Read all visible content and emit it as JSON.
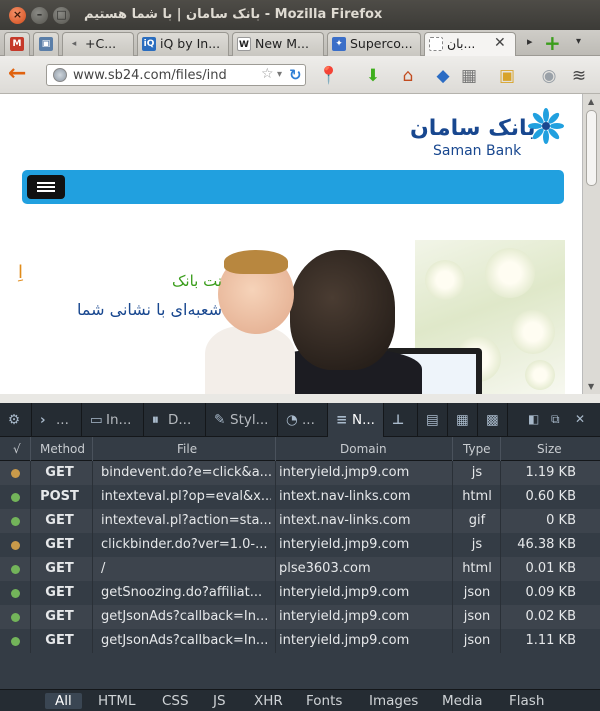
{
  "window": {
    "title": "بانک سامان | با شما هستیم - Mozilla Firefox",
    "buttons": {
      "close": "×",
      "minimize": "–",
      "maximize": "□"
    }
  },
  "tabs": [
    {
      "label": "",
      "icon": "gmail-icon",
      "icon_color": "#c5392a"
    },
    {
      "label": "",
      "icon": "photo-icon",
      "icon_color": "#5a7ea8"
    },
    {
      "label": "+C...",
      "icon": "gplus-icon",
      "icon_color": "#cfcdc8"
    },
    {
      "label": "iQ by In...",
      "icon": "iq-icon",
      "icon_color": "#2a6dbf"
    },
    {
      "label": "New M...",
      "icon": "wikipedia-icon",
      "icon_color": "#444444"
    },
    {
      "label": "Superco...",
      "icon": "supercomputer-icon",
      "icon_color": "#3a6ec8"
    },
    {
      "label": "بان...",
      "icon": "blank-page-icon",
      "icon_color": "#ffffff",
      "active": true
    }
  ],
  "tab_controls": {
    "close": "✕",
    "scroll_right": "▸",
    "new_tab": "+",
    "list_all": "▾"
  },
  "navbar": {
    "url": "www.sb24.com/files/ind",
    "bookmark_star": "☆",
    "dropdown": "▾",
    "reload": "↻",
    "back": "←"
  },
  "nav_icons": [
    {
      "name": "pin-tool-icon",
      "glyph": "📍",
      "color": "#c0392b"
    },
    {
      "name": "download-icon",
      "glyph": "⬇",
      "color": "#3eae1c"
    },
    {
      "name": "home-icon",
      "glyph": "⌂",
      "color": "#c24b1e"
    },
    {
      "name": "bookmark-icon",
      "glyph": "◆",
      "color": "#2b6cc4"
    },
    {
      "name": "bookmarks-grid-icon",
      "glyph": "▦",
      "color": "#777777"
    },
    {
      "name": "notes-icon",
      "glyph": "▣",
      "color": "#d8a32a"
    },
    {
      "name": "addon-icon",
      "glyph": "◉",
      "color": "#9aa1a8"
    },
    {
      "name": "layers-icon",
      "glyph": "≋",
      "color": "#444444"
    }
  ],
  "page": {
    "logo_fa": "بانک سامان",
    "logo_en": "Saman Bank",
    "hero_line1": "نت بانک",
    "hero_line2": "شعبه‌ای با نشانی شما",
    "hero_edge": "اِ"
  },
  "colors": {
    "brand_blue": "#18478f",
    "menu_bar": "#21a0df",
    "accent_green": "#3a9d1b"
  },
  "devtools": {
    "tabs": [
      {
        "name": "settings",
        "icon": "⚙",
        "label": ""
      },
      {
        "name": "console",
        "icon": "›",
        "label": "..."
      },
      {
        "name": "inspector",
        "icon": "▭",
        "label": "In..."
      },
      {
        "name": "debugger",
        "icon": "⏸",
        "label": "D..."
      },
      {
        "name": "style-editor",
        "icon": "✎",
        "label": "Styl..."
      },
      {
        "name": "profiler",
        "icon": "◔",
        "label": "..."
      },
      {
        "name": "network",
        "icon": "≡",
        "label": "N...",
        "active": true
      },
      {
        "name": "measure",
        "icon": "⊥",
        "label": ""
      },
      {
        "name": "responsive",
        "icon": "▤",
        "label": ""
      },
      {
        "name": "screenshot",
        "icon": "▦",
        "label": ""
      },
      {
        "name": "scratchpad",
        "icon": "▩",
        "label": ""
      }
    ],
    "controls": {
      "dock": "◧",
      "undock": "⧉",
      "close": "✕"
    },
    "headers": {
      "status": "√",
      "method": "Method",
      "file": "File",
      "domain": "Domain",
      "type": "Type",
      "size": "Size"
    },
    "rows": [
      {
        "status_color": "#c99a4a",
        "method": "GET",
        "file": "bindevent.do?e=click&a...",
        "domain": "interyield.jmp9.com",
        "type": "js",
        "size": "1.19 KB"
      },
      {
        "status_color": "#73b45a",
        "method": "POST",
        "file": "intexteval.pl?op=eval&x...",
        "domain": "intext.nav-links.com",
        "type": "html",
        "size": "0.60 KB"
      },
      {
        "status_color": "#73b45a",
        "method": "GET",
        "file": "intexteval.pl?action=sta...",
        "domain": "intext.nav-links.com",
        "type": "gif",
        "size": "0 KB"
      },
      {
        "status_color": "#c99a4a",
        "method": "GET",
        "file": "clickbinder.do?ver=1.0-...",
        "domain": "interyield.jmp9.com",
        "type": "js",
        "size": "46.38 KB"
      },
      {
        "status_color": "#73b45a",
        "method": "GET",
        "file": "/",
        "domain": "plse3603.com",
        "type": "html",
        "size": "0.01 KB"
      },
      {
        "status_color": "#73b45a",
        "method": "GET",
        "file": "getSnoozing.do?affiliat...",
        "domain": "interyield.jmp9.com",
        "type": "json",
        "size": "0.09 KB"
      },
      {
        "status_color": "#73b45a",
        "method": "GET",
        "file": "getJsonAds?callback=In...",
        "domain": "interyield.jmp9.com",
        "type": "json",
        "size": "0.02 KB"
      },
      {
        "status_color": "#73b45a",
        "method": "GET",
        "file": "getJsonAds?callback=In...",
        "domain": "interyield.jmp9.com",
        "type": "json",
        "size": "1.11 KB"
      }
    ],
    "filters": [
      {
        "label": "All",
        "active": true
      },
      {
        "label": "HTML"
      },
      {
        "label": "CSS"
      },
      {
        "label": "JS"
      },
      {
        "label": "XHR"
      },
      {
        "label": "Fonts"
      },
      {
        "label": "Images"
      },
      {
        "label": "Media"
      },
      {
        "label": "Flash"
      }
    ]
  }
}
